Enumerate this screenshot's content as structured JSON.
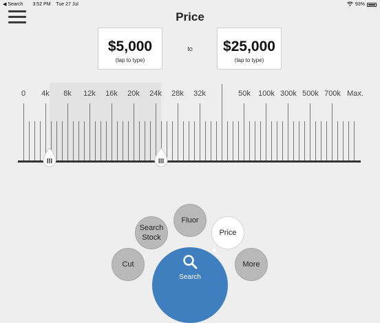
{
  "status_bar": {
    "back_app": "Search",
    "time": "3:52 PM",
    "date": "Tue 27 Jul",
    "battery": "93%"
  },
  "page": {
    "title": "Price"
  },
  "price_range": {
    "min": {
      "value": "$5,000",
      "hint": "(tap to type)"
    },
    "separator": "to",
    "max": {
      "value": "$25,000",
      "hint": "(tap to type)"
    }
  },
  "scale": {
    "labels": [
      "0",
      "4k",
      "8k",
      "12k",
      "16k",
      "20k",
      "24k",
      "28k",
      "32k",
      "50k",
      "100k",
      "300k",
      "500k",
      "700k",
      "Max."
    ],
    "selected_min": "5k",
    "selected_max": "25k"
  },
  "menu": {
    "search_stock": "Search Stock",
    "fluor": "Fluor",
    "price": "Price",
    "cut": "Cut",
    "more": "More",
    "search": "Search"
  },
  "colors": {
    "accent": "#3f7fbf",
    "track": "#333333",
    "bubble": "#b9b9b9",
    "background": "#eeeeee"
  }
}
